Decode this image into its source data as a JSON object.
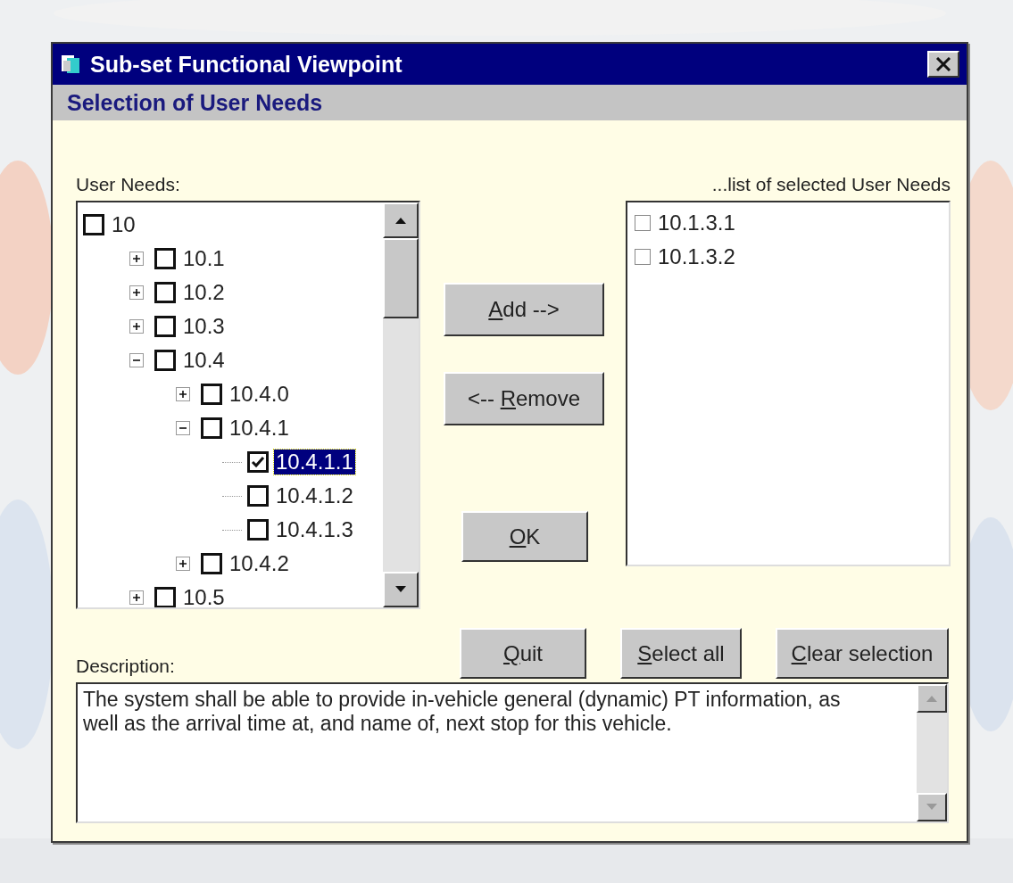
{
  "window": {
    "title": "Sub-set Functional Viewpoint",
    "subtitle": "Selection of User Needs"
  },
  "tree": {
    "label": "User Needs:",
    "items": [
      {
        "label": "10",
        "checked": false,
        "selected": false,
        "children": [
          {
            "label": "10.1",
            "checked": false,
            "selected": false,
            "expanded": false
          },
          {
            "label": "10.2",
            "checked": false,
            "selected": false,
            "expanded": false
          },
          {
            "label": "10.3",
            "checked": false,
            "selected": false,
            "expanded": false
          },
          {
            "label": "10.4",
            "checked": false,
            "selected": false,
            "expanded": true,
            "children": [
              {
                "label": "10.4.0",
                "checked": false,
                "selected": false,
                "expanded": false
              },
              {
                "label": "10.4.1",
                "checked": false,
                "selected": false,
                "expanded": true,
                "children": [
                  {
                    "label": "10.4.1.1",
                    "checked": true,
                    "selected": true
                  },
                  {
                    "label": "10.4.1.2",
                    "checked": false,
                    "selected": false
                  },
                  {
                    "label": "10.4.1.3",
                    "checked": false,
                    "selected": false
                  }
                ]
              },
              {
                "label": "10.4.2",
                "checked": false,
                "selected": false,
                "expanded": false
              }
            ]
          },
          {
            "label": "10.5",
            "checked": false,
            "selected": false,
            "expanded": false
          }
        ]
      }
    ]
  },
  "selected_list": {
    "label": "...list of selected User Needs",
    "items": [
      {
        "label": "10.1.3.1",
        "checked": false
      },
      {
        "label": "10.1.3.2",
        "checked": false
      }
    ]
  },
  "buttons": {
    "add": {
      "key": "A",
      "after": "dd  -->"
    },
    "remove": {
      "before": "<-- ",
      "key": "R",
      "after": "emove"
    },
    "ok": {
      "key": "O",
      "after": "K"
    },
    "quit": {
      "key": "Q",
      "after": "uit"
    },
    "select_all": {
      "key": "S",
      "after": "elect all"
    },
    "clear_selection": {
      "key": "C",
      "after": "lear selection"
    }
  },
  "description": {
    "label": "Description:",
    "value": "The system shall be able to provide in-vehicle general (dynamic) PT information, as well as the arrival time at, and name of, next stop for this vehicle."
  }
}
